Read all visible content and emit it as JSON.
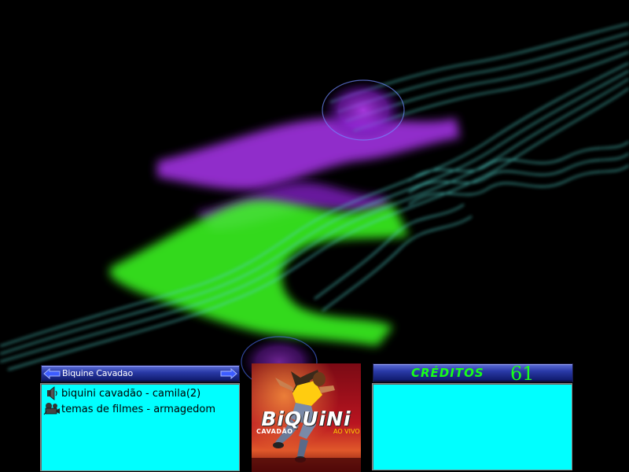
{
  "playlist": {
    "title": "Biquine Cavadao",
    "tracks": [
      {
        "icon": "speaker-icon",
        "label": "biquini cavadão - camila(2)"
      },
      {
        "icon": "film-camera-icon",
        "label": "temas de filmes - armagedom"
      }
    ]
  },
  "album_cover": {
    "artist": "BiQUiNi",
    "subtitle": "CAVADÃO",
    "tagline": "AO VIVO"
  },
  "credits": {
    "label": "CRÉDITOS",
    "value": "61"
  },
  "colors": {
    "panel_background": "#00ffff",
    "bar_navy": "#2a3aa8",
    "credits_green": "#19ff19",
    "wallpaper_purple": "#a030ff",
    "wallpaper_green": "#3cff20",
    "wallpaper_teal": "#40c8c0"
  }
}
